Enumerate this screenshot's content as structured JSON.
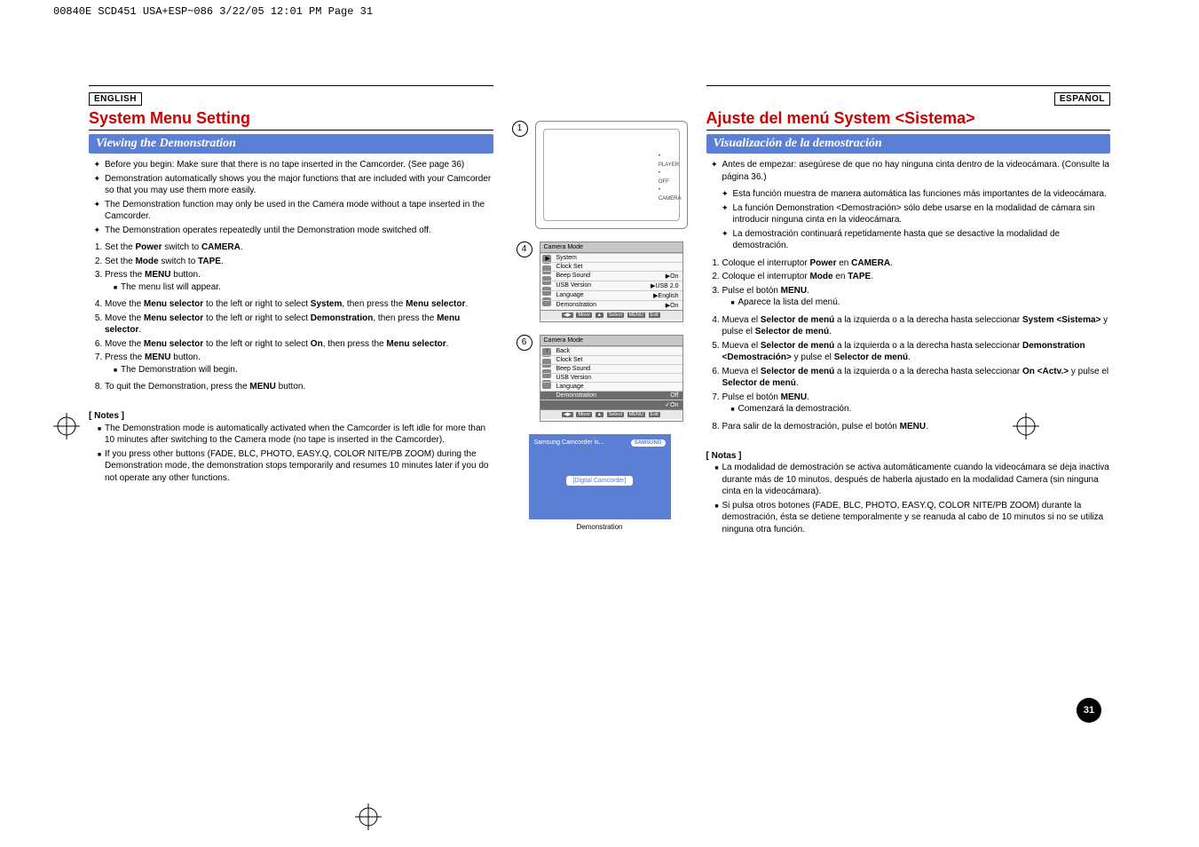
{
  "header": "00840E SCD451 USA+ESP~086  3/22/05 12:01 PM  Page 31",
  "page_number": "31",
  "left": {
    "lang": "ENGLISH",
    "title": "System Menu Setting",
    "section": "Viewing the Demonstration",
    "intro": [
      "Before you begin: Make sure that there is no tape inserted in the Camcorder. (See page 36)",
      "Demonstration automatically shows you the major functions that are included with your Camcorder so that you may use them more easily.",
      "The Demonstration function may only be used in the Camera mode without a tape inserted in the Camcorder.",
      "The Demonstration operates repeatedly until the Demonstration mode switched off."
    ],
    "steps": {
      "s1": "Set the Power switch to CAMERA.",
      "s2": "Set the Mode switch to TAPE.",
      "s3": "Press the MENU button.",
      "s3a": "The menu list will appear.",
      "s4": "Move the Menu selector to the left or right to select System, then press the Menu selector.",
      "s5": "Move the Menu selector to the left or right to select Demonstration, then press the Menu selector.",
      "s6": "Move the Menu selector to the left or right to select On, then press the Menu selector.",
      "s7": "Press the MENU button.",
      "s7a": "The Demonstration will begin.",
      "s8": "To quit the Demonstration, press the MENU button."
    },
    "notes_h": "[ Notes ]",
    "notes": [
      "The Demonstration mode is automatically activated when the Camcorder is left idle for more than 10 minutes after switching to the Camera mode (no tape is inserted in the Camcorder).",
      "If you press other buttons (FADE, BLC, PHOTO, EASY.Q, COLOR NITE/PB ZOOM) during the Demonstration mode, the demonstration stops temporarily and resumes 10 minutes later if you do not operate any other functions."
    ]
  },
  "right": {
    "lang": "ESPAÑOL",
    "title": "Ajuste del menú System <Sistema>",
    "section": "Visualización de la demostración",
    "intro_lead": "Antes de empezar: asegúrese de que no hay ninguna cinta dentro de la videocámara. (Consulte la página 36.)",
    "intro": [
      "Esta función muestra de manera automática las funciones más importantes de la videocámara.",
      "La función Demonstration <Demostración> sólo debe usarse en la modalidad de cámara sin introducir ninguna cinta en la videocámara.",
      "La demostración continuará repetidamente hasta que se desactive la modalidad de demostración."
    ],
    "steps": {
      "s1": "Coloque el interruptor Power en CAMERA.",
      "s2": "Coloque el interruptor Mode en TAPE.",
      "s3": "Pulse el botón MENU.",
      "s3a": "Aparece la lista del menú.",
      "s4": "Mueva el Selector de menú a la izquierda o a la derecha hasta seleccionar System <Sistema> y pulse el Selector de menú.",
      "s5": "Mueva el Selector de menú a la izquierda o a la derecha hasta seleccionar Demonstration <Demostración> y pulse el Selector de menú.",
      "s6": "Mueva el Selector de menú a la izquierda o a la derecha hasta seleccionar On <Actv.> y pulse el Selector de menú.",
      "s7": "Pulse el botón MENU.",
      "s7a": "Comenzará la demostración.",
      "s8": "Para salir de la demostración, pulse el botón MENU."
    },
    "notes_h": "[ Notas ]",
    "notes": [
      "La modalidad de demostración se activa automáticamente cuando la videocámara se deja inactiva durante más de 10 minutos, después de haberla ajustado en la modalidad Camera (sin ninguna cinta en la videocámara).",
      "Si pulsa otros botones (FADE, BLC, PHOTO, EASY.Q, COLOR NITE/PB ZOOM) durante la demostración, ésta se detiene temporalmente y se reanuda al cabo de 10 minutos si no se utiliza ninguna otra función."
    ]
  },
  "illus": {
    "num1": "1",
    "num4": "4",
    "num6": "6",
    "mode_player": "PLAYER",
    "mode_off": "OFF",
    "mode_camera": "CAMERA",
    "osd1": {
      "title": "Camera Mode",
      "r_system": "System",
      "r_clock": "Clock Set",
      "r_beep": "Beep Sound",
      "v_beep": "On",
      "r_usb": "USB Version",
      "v_usb": "USB 2.0",
      "r_lang": "Language",
      "v_lang": "English",
      "r_demo": "Demonstration",
      "v_demo": "On",
      "legend_move": "Move",
      "legend_select": "Select",
      "legend_exit": "Exit",
      "legend_menu": "MENU"
    },
    "osd2": {
      "title": "Camera Mode",
      "r_back": "Back",
      "r_clock": "Clock Set",
      "r_beep": "Beep Sound",
      "r_usb": "USB Version",
      "r_lang": "Language",
      "r_demo": "Demonstration",
      "v_off": "Off",
      "v_on": "On",
      "legend_move": "Move",
      "legend_select": "Select",
      "legend_exit": "Exit",
      "legend_menu": "MENU"
    },
    "demo": {
      "top_text": "Samsung Camcorder is...",
      "brand": "SAMSUNG",
      "pill": "[Digital Camcorder]",
      "caption": "Demonstration"
    }
  }
}
